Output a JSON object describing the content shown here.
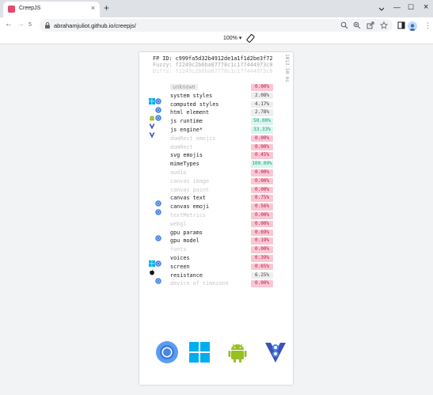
{
  "browser": {
    "tab_title": "CreepJS",
    "tab_close": "×",
    "new_tab": "+",
    "url": "abrahamjuliot.github.io/creepjs/",
    "back": "←",
    "forward": "→",
    "reload": "↻",
    "tab_count": "5",
    "minimize": "—",
    "maximize": "☐",
    "close": "×",
    "menu": "⋮"
  },
  "devtools": {
    "zoom": "100% ▾"
  },
  "fingerprint": {
    "fp_id": "FP ID: c999fa5d32b4912de1a1f1d2be3f72",
    "fuzzy": "Fuzzy: f2249c2b6ba87778c1c177444973c0",
    "diffs": "Diffs: f2249c2b6ba87778c1c177444973c0",
    "timing": "1013.50 ms"
  },
  "rows": [
    {
      "label": "unknown",
      "value": "0.00%",
      "style": "boxed",
      "icons": []
    },
    {
      "label": "system styles",
      "value": "2.08%",
      "style": "normal",
      "icons": [
        "windows-icon",
        "chromium-icon"
      ]
    },
    {
      "label": "computed styles",
      "value": "4.17%",
      "style": "normal",
      "icons": [
        "",
        "chromium-icon"
      ]
    },
    {
      "label": "html element",
      "value": "2.78%",
      "style": "normal",
      "icons": [
        "android-icon",
        "chromium-icon"
      ]
    },
    {
      "label": "js runtime",
      "value": "50.00%",
      "style": "normal",
      "icons": [
        "v8-icon",
        ""
      ]
    },
    {
      "label": "js engine*",
      "value": "33.33%",
      "style": "normal",
      "icons": [
        "v8-icon",
        ""
      ]
    },
    {
      "label": "domRect emojis",
      "value": "0.00%",
      "style": "muted",
      "icons": []
    },
    {
      "label": "domRect",
      "value": "0.00%",
      "style": "muted",
      "icons": []
    },
    {
      "label": "svg emojis",
      "value": "0.45%",
      "style": "normal",
      "icons": []
    },
    {
      "label": "mimeTypes",
      "value": "100.00%",
      "style": "normal",
      "icons": []
    },
    {
      "label": "audio",
      "value": "0.00%",
      "style": "muted",
      "icons": []
    },
    {
      "label": "canvas image",
      "value": "0.00%",
      "style": "muted",
      "icons": []
    },
    {
      "label": "canvas paint",
      "value": "0.00%",
      "style": "muted",
      "icons": []
    },
    {
      "label": "canvas text",
      "value": "0.75%",
      "style": "normal",
      "icons": [
        "",
        "chromium-icon"
      ]
    },
    {
      "label": "canvas emoji",
      "value": "0.56%",
      "style": "normal",
      "icons": [
        "",
        "chromium-icon"
      ]
    },
    {
      "label": "textMetrics",
      "value": "0.00%",
      "style": "muted",
      "icons": []
    },
    {
      "label": "webgl",
      "value": "0.00%",
      "style": "muted",
      "icons": []
    },
    {
      "label": "gpu params",
      "value": "0.69%",
      "style": "normal",
      "icons": [
        "",
        "chromium-icon"
      ]
    },
    {
      "label": "gpu model",
      "value": "0.19%",
      "style": "normal",
      "icons": []
    },
    {
      "label": "fonts",
      "value": "0.00%",
      "style": "muted",
      "icons": []
    },
    {
      "label": "voices",
      "value": "0.39%",
      "style": "normal",
      "icons": [
        "windows-icon",
        "chromium-icon"
      ]
    },
    {
      "label": "screen",
      "value": "0.65%",
      "style": "normal",
      "icons": [
        "apple-icon",
        ""
      ]
    },
    {
      "label": "resistance",
      "value": "6.25%",
      "style": "normal",
      "icons": [
        "",
        "chromium-icon"
      ]
    },
    {
      "label": "device of timezone",
      "value": "0.00%",
      "style": "muted",
      "icons": []
    }
  ],
  "colors": {
    "red_bg": "#f8c8d2",
    "red_fg": "#c2185b",
    "grey_bg": "#eeeeee",
    "grey_fg": "#444444",
    "green_bg": "#d9f5ee",
    "green_fg": "#1c9e76"
  },
  "logos": [
    "chromium-logo-icon",
    "windows-logo-icon",
    "android-logo-icon",
    "v8-logo-icon"
  ]
}
